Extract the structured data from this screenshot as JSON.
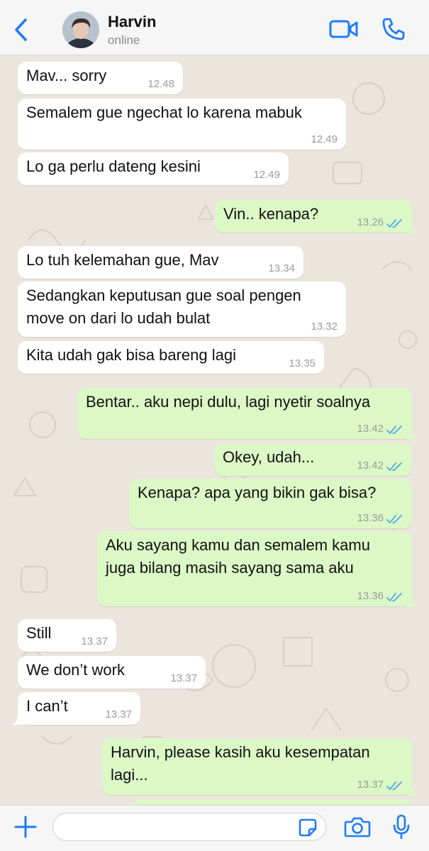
{
  "header": {
    "back_icon": "chevron-left-icon",
    "contact_name": "Harvin",
    "status": "online",
    "video_icon": "video-camera-icon",
    "call_icon": "phone-icon"
  },
  "colors": {
    "accent": "#1F7CF5",
    "incoming_bubble": "#FFFFFF",
    "outgoing_bubble": "#DCF8C6",
    "wallpaper": "#ECE5DD",
    "read_ticks": "#4FA8E8"
  },
  "messages": [
    {
      "dir": "in",
      "text": "Mav... sorry",
      "time": "12.48"
    },
    {
      "dir": "in",
      "text": "Semalem gue ngechat lo karena mabuk",
      "time": "12.49"
    },
    {
      "dir": "in",
      "text": "Lo ga perlu dateng kesini",
      "time": "12.49"
    },
    {
      "dir": "out",
      "text": "Vin.. kenapa?",
      "time": "13.26",
      "status": "read"
    },
    {
      "dir": "in",
      "text": "Lo tuh kelemahan gue, Mav",
      "time": "13.34"
    },
    {
      "dir": "in",
      "text": "Sedangkan keputusan gue soal pengen\nmove on dari lo udah bulat",
      "time": "13.32"
    },
    {
      "dir": "in",
      "text": "Kita udah gak bisa bareng lagi",
      "time": "13.35"
    },
    {
      "dir": "out",
      "text": "Bentar.. aku nepi dulu, lagi nyetir soalnya",
      "time": "13.42",
      "status": "read"
    },
    {
      "dir": "out",
      "text": "Okey, udah...",
      "time": "13.42",
      "status": "read"
    },
    {
      "dir": "out",
      "text": "Kenapa? apa yang bikin gak bisa?",
      "time": "13.36",
      "status": "read"
    },
    {
      "dir": "out",
      "text": "Aku sayang kamu dan semalem kamu\njuga bilang masih sayang sama aku",
      "time": "13.36",
      "status": "read"
    },
    {
      "dir": "in",
      "text": "Still",
      "time": "13.37"
    },
    {
      "dir": "in",
      "text": "We don’t work",
      "time": "13.37"
    },
    {
      "dir": "in",
      "text": "I can’t",
      "time": "13.37"
    },
    {
      "dir": "out",
      "text": "Harvin, please kasih aku kesempatan\nlagi...",
      "time": "13.37",
      "status": "read"
    }
  ],
  "footer": {
    "add_icon": "plus-icon",
    "input_value": "",
    "input_placeholder": "",
    "sticker_icon": "sticker-icon",
    "camera_icon": "camera-icon",
    "mic_icon": "microphone-icon"
  }
}
